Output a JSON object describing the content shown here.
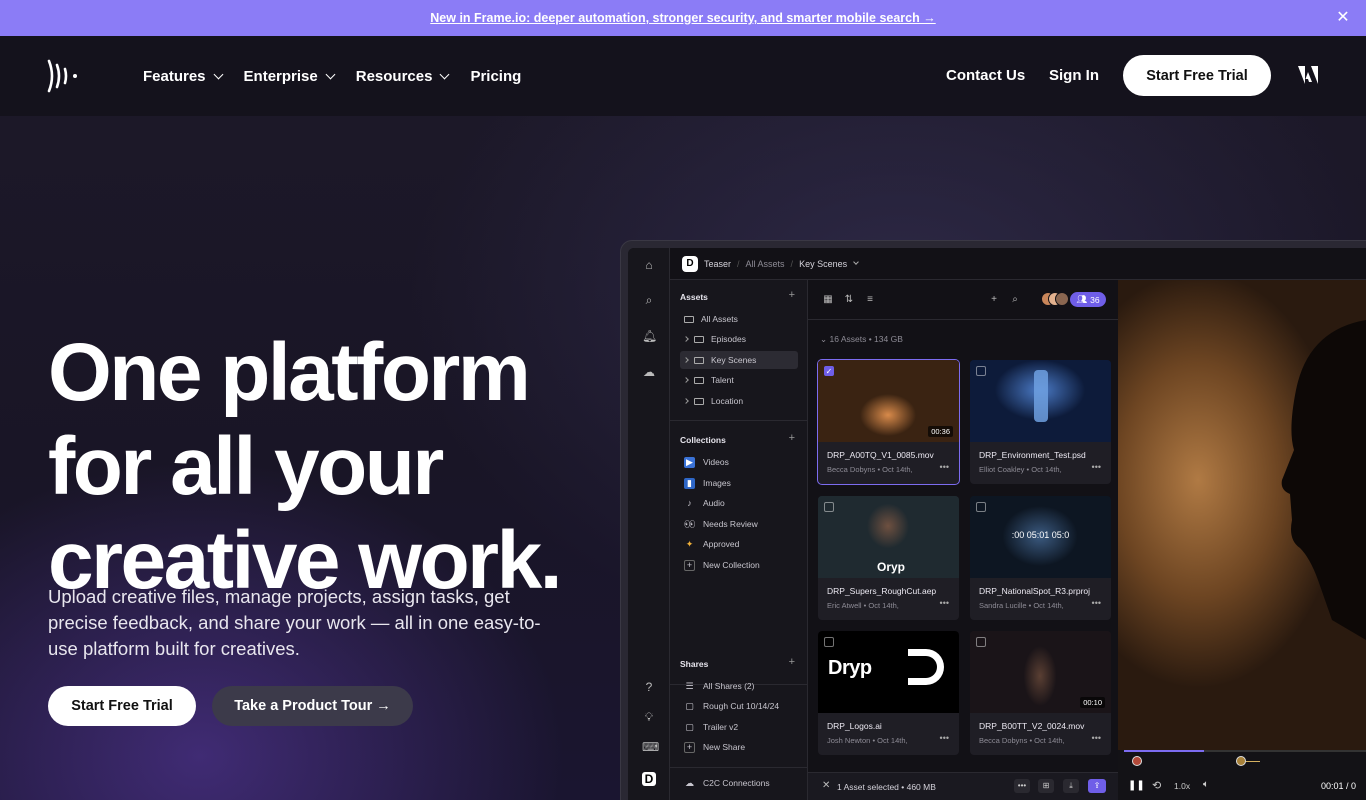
{
  "announcement": {
    "text": "New in Frame.io: deeper automation, stronger security, and smarter mobile search →"
  },
  "nav": {
    "items": [
      {
        "label": "Features",
        "has_dropdown": true
      },
      {
        "label": "Enterprise",
        "has_dropdown": true
      },
      {
        "label": "Resources",
        "has_dropdown": true
      },
      {
        "label": "Pricing",
        "has_dropdown": false
      }
    ],
    "contact": "Contact Us",
    "signin": "Sign In",
    "trial": "Start Free Trial"
  },
  "hero": {
    "headline_line1": "One platform",
    "headline_line2": "for all your",
    "headline_line3": "creative work.",
    "subtext": "Upload creative files, manage projects, assign tasks, get precise feedback, and share your work — all in one easy-to-use platform built for creatives.",
    "cta_primary": "Start Free Trial",
    "cta_secondary": "Take a Product Tour →"
  },
  "app": {
    "breadcrumb": {
      "workspace_badge": "D",
      "project": "Teaser",
      "parent": "All Assets",
      "current": "Key Scenes"
    },
    "assets_heading": "Assets",
    "assets_tree": [
      {
        "label": "All Assets",
        "caret": false,
        "selected": false
      },
      {
        "label": "Episodes",
        "caret": true,
        "selected": false
      },
      {
        "label": "Key Scenes",
        "caret": true,
        "selected": true
      },
      {
        "label": "Talent",
        "caret": true,
        "selected": false
      },
      {
        "label": "Location",
        "caret": true,
        "selected": false
      }
    ],
    "collections_heading": "Collections",
    "collections": [
      {
        "label": "Videos",
        "icon": "video-icon"
      },
      {
        "label": "Images",
        "icon": "image-icon"
      },
      {
        "label": "Audio",
        "icon": "audio-icon"
      },
      {
        "label": "Needs Review",
        "icon": "eyes-icon"
      },
      {
        "label": "Approved",
        "icon": "party-icon"
      },
      {
        "label": "New Collection",
        "icon": "plus-icon"
      }
    ],
    "shares_heading": "Shares",
    "shares": [
      {
        "label": "All Shares (2)"
      },
      {
        "label": "Rough Cut 10/14/24"
      },
      {
        "label": "Trailer v2"
      },
      {
        "label": "New Share"
      }
    ],
    "c2c": "C2C Connections",
    "member_count": "36",
    "assets_meta": "16 Assets  •  134 GB",
    "cards": [
      {
        "title": "DRP_A00TQ_V1_0085.mov",
        "author": "Becca Dobyns",
        "date": "Oct 14th,",
        "duration": "00:36",
        "selected": true,
        "thumb": "dark-corridor"
      },
      {
        "title": "DRP_Environment_Test.psd",
        "author": "Elliot Coakley",
        "date": "Oct 14th,",
        "duration": "",
        "selected": false,
        "thumb": "blue-bottle"
      },
      {
        "title": "DRP_Supers_RoughCut.aep",
        "author": "Eric Atwell",
        "date": "Oct 14th,",
        "duration": "",
        "selected": false,
        "thumb": "portrait-oryp"
      },
      {
        "title": "DRP_NationalSpot_R3.prproj",
        "author": "Sandra Lucille",
        "date": "Oct 14th,",
        "duration": "",
        "selected": false,
        "thumb": "timeline-blue"
      },
      {
        "title": "DRP_Logos.ai",
        "author": "Josh Newton",
        "date": "Oct 14th,",
        "duration": "",
        "selected": false,
        "thumb": "logo-dryp"
      },
      {
        "title": "DRP_B00TT_V2_0024.mov",
        "author": "Becca Dobyns",
        "date": "Oct 14th,",
        "duration": "00:10",
        "selected": false,
        "thumb": "street-night"
      }
    ],
    "timeline_text": ":00   05:01   05:0",
    "logo_text": "Dryp",
    "oryp_text": "Oryp",
    "selection_bar": "1 Asset selected  •  460 MB",
    "player": {
      "speed": "1.0x",
      "time": "00:01 / 0"
    }
  },
  "colors": {
    "announce": "#8b7cf6",
    "accent": "#6f5ee8",
    "nav_bg": "#14121c"
  }
}
